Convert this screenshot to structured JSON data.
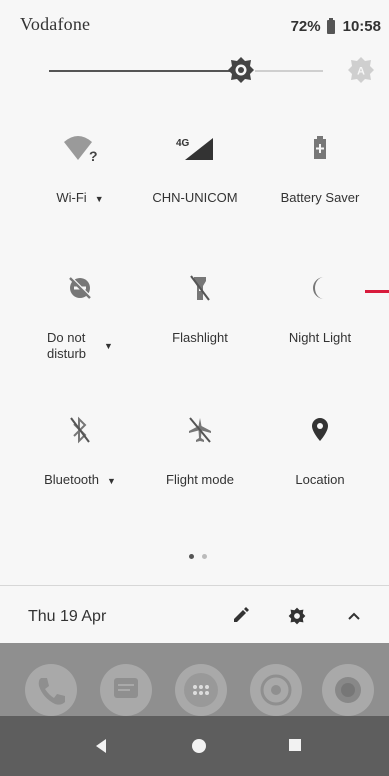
{
  "status_bar": {
    "carrier": "Vodafone",
    "battery": "72%",
    "time": "10:58"
  },
  "brightness": {
    "level": 0.58,
    "auto_icon": "auto-brightness-icon"
  },
  "tiles": [
    {
      "label": "Wi-Fi",
      "icon": "wifi-question-icon",
      "has_dropdown": true
    },
    {
      "label": "CHN-UNICOM",
      "icon": "signal-4g-icon",
      "network": "4G",
      "has_dropdown": false
    },
    {
      "label": "Battery Saver",
      "icon": "battery-saver-icon",
      "has_dropdown": false
    },
    {
      "label": "Do not\ndisturb",
      "icon": "do-not-disturb-icon",
      "has_dropdown": true
    },
    {
      "label": "Flashlight",
      "icon": "flashlight-icon",
      "has_dropdown": false
    },
    {
      "label": "Night Light",
      "icon": "night-light-icon",
      "has_dropdown": false
    },
    {
      "label": "Bluetooth",
      "icon": "bluetooth-off-icon",
      "has_dropdown": true
    },
    {
      "label": "Flight mode",
      "icon": "airplane-off-icon",
      "has_dropdown": false
    },
    {
      "label": "Location",
      "icon": "location-pin-icon",
      "has_dropdown": false
    }
  ],
  "pager": {
    "pages": 2,
    "current": 1
  },
  "footer": {
    "date": "Thu 19 Apr",
    "edit_icon": "pencil-icon",
    "settings_icon": "gear-icon",
    "collapse_icon": "chevron-up-icon"
  },
  "dock": [
    "phone-icon",
    "messages-icon",
    "app-drawer-icon",
    "chrome-icon",
    "camera-icon"
  ],
  "nav": [
    "back-icon",
    "home-icon",
    "recents-icon"
  ],
  "colors": {
    "accent_mark": "#d81b3c",
    "icon": "#4a4a4a",
    "panel_bg": "#f7f7f7"
  }
}
